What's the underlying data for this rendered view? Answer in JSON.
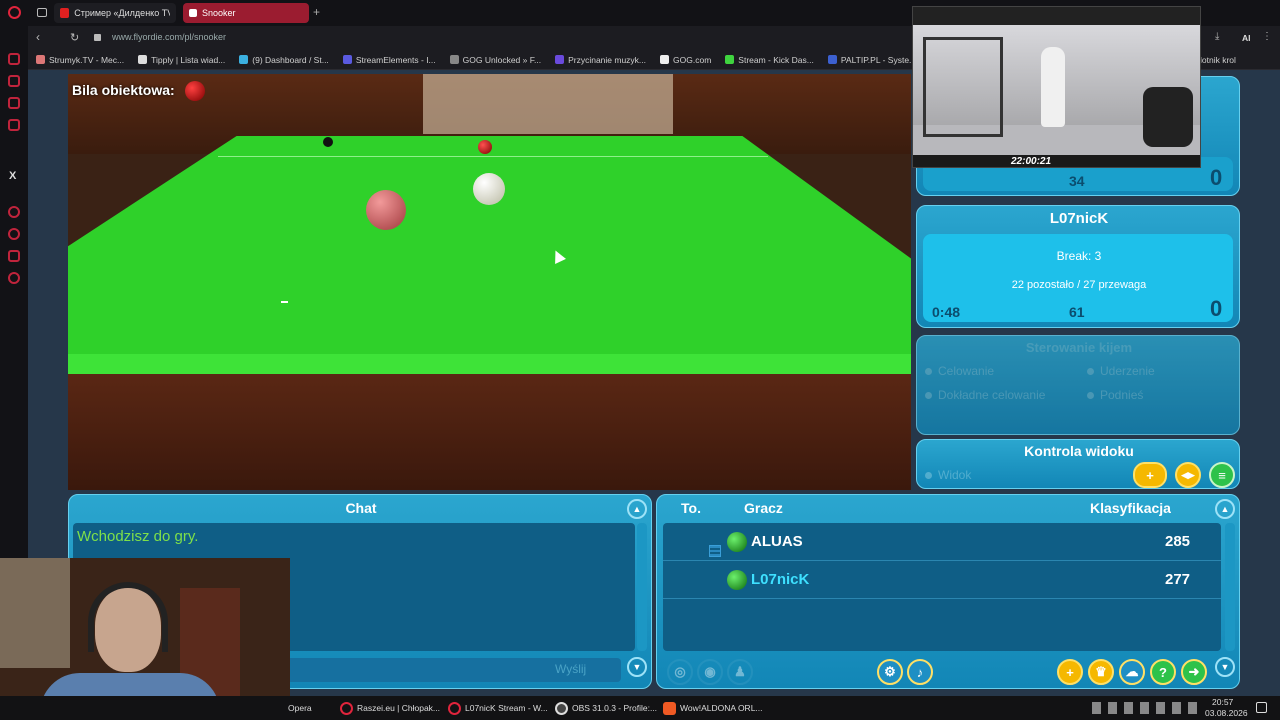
{
  "browser": {
    "tabs": [
      {
        "label": "Стример «Дилденко TV»"
      },
      {
        "label": "Snooker"
      }
    ],
    "new_tab": "+",
    "url": "www.flyordie.com/pl/snooker",
    "ai_label": "AI",
    "bookmarks": [
      "Strumyk.TV - Mec...",
      "Tipply | Lista wiad...",
      "(9) Dashboard / St...",
      "StreamElements - I...",
      "GOG Unlocked » F...",
      "Przycinanie muzyk...",
      "GOG.com",
      "Stream - Kick Das...",
      "PALTIP.PL - Syste...",
      "lotnik krol"
    ]
  },
  "game": {
    "object_ball_label": "Bila obiektowa:",
    "opponent": {
      "score_small": "34",
      "frame": "0"
    },
    "player": {
      "name": "L07nicK",
      "break_text": "Break: 3",
      "remaining_text": "22 pozostało / 27 przewaga",
      "timer": "0:48",
      "points": "61",
      "frame": "0"
    },
    "cue_control": {
      "title": "Sterowanie kijem",
      "options": [
        "Celowanie",
        "Uderzenie",
        "Dokładne celowanie",
        "Podnieś"
      ]
    },
    "view_control": {
      "title": "Kontrola widoku",
      "option": "Widok"
    },
    "chat": {
      "title": "Chat",
      "message": "Wchodzisz do gry.",
      "send_label": "Wyślij"
    },
    "players_table": {
      "col_to": "To.",
      "col_player": "Gracz",
      "col_rank": "Klasyfikacja",
      "rows": [
        {
          "name": "ALUAS",
          "rating": "285"
        },
        {
          "name": "L07nicK",
          "rating": "277"
        }
      ]
    }
  },
  "stream_overlay": {
    "clock": "22:00:21"
  },
  "taskbar": {
    "items": [
      "Opera",
      "Raszei.eu | Chłopak...",
      "L07nicK Stream - W...",
      "OBS 31.0.3 - Profile:...",
      "Wow!ALDONA ORL..."
    ],
    "time": "20:57",
    "date": "03.08.2026"
  },
  "colors": {
    "felt": "#2fd12a",
    "panel": "#1e9fcc",
    "accent_red": "#c0243c"
  }
}
